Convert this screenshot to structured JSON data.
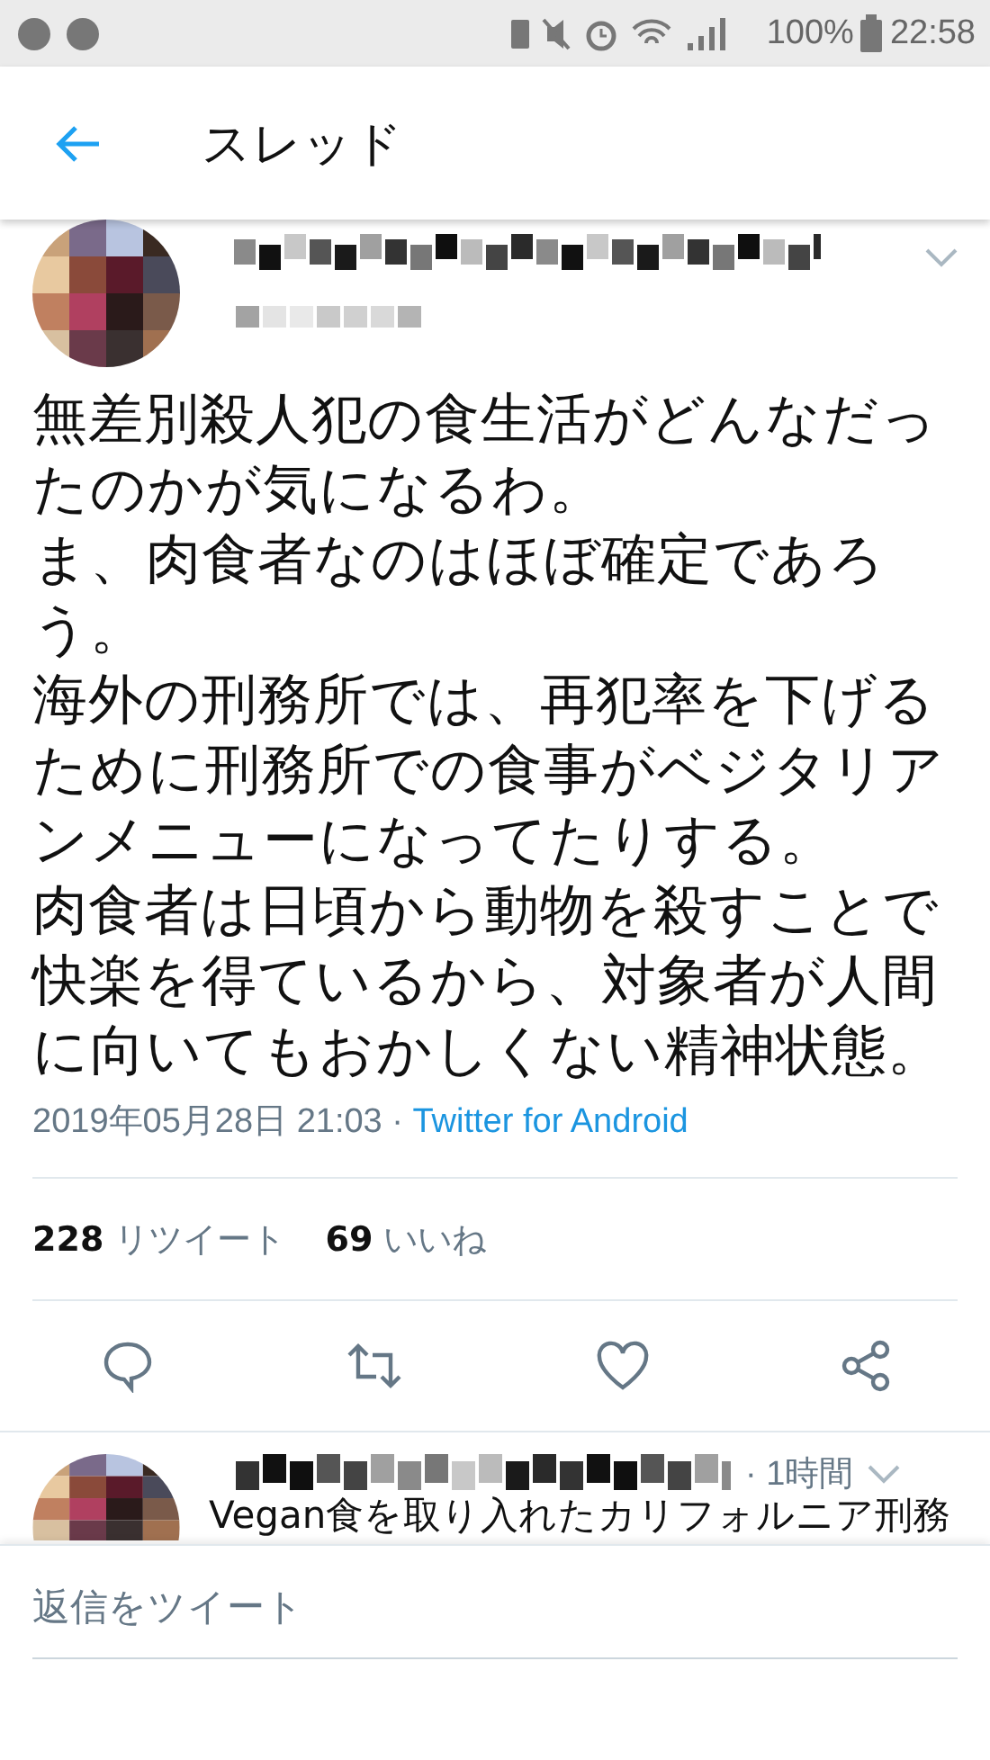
{
  "status_bar": {
    "battery": "100%",
    "time": "22:58"
  },
  "header": {
    "title": "スレッド"
  },
  "tweet": {
    "paragraphs": [
      "無差別殺人犯の食生活がどんなだったのかが気になるわ。",
      "ま、肉食者なのはほぼ確定であろう。",
      "海外の刑務所では、再犯率を下げるために刑務所での食事がベジタリアンメニューになってたりする。",
      "肉食者は日頃から動物を殺すことで快楽を得ているから、対象者が人間に向いてもおかしくない精神状態。"
    ],
    "date": "2019年05月28日 21:03 ·",
    "source": "Twitter for Android",
    "retweets": {
      "count": "228",
      "label": "リツイート"
    },
    "likes": {
      "count": "69",
      "label": "いいね"
    }
  },
  "reply": {
    "time": "· 1時間",
    "text": "Vegan食を取り入れたカリフォルニア刑務"
  },
  "compose": {
    "placeholder": "返信をツイート"
  }
}
